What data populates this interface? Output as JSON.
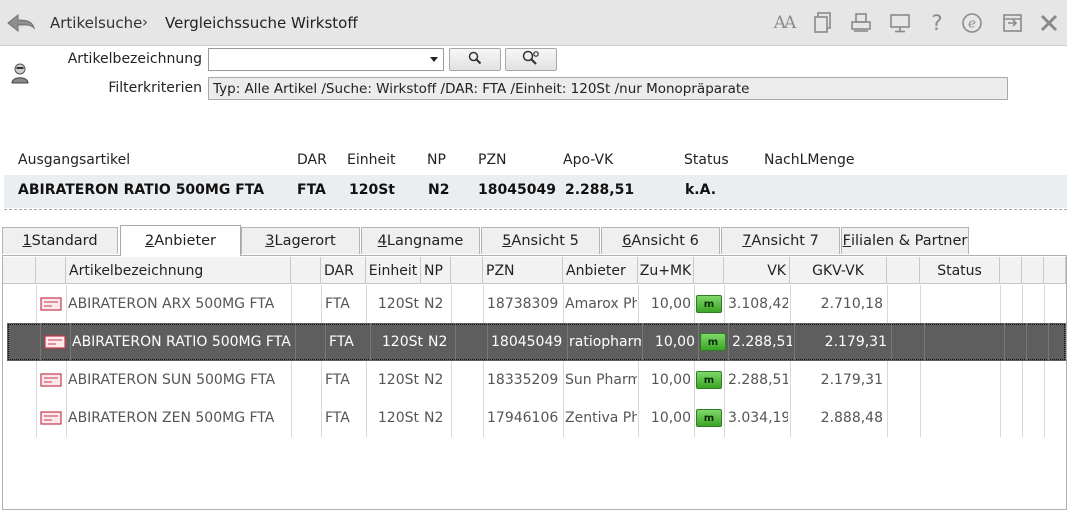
{
  "header": {
    "breadcrumb_1": "Artikelsuche",
    "breadcrumb_sep": "›",
    "breadcrumb_2": "Vergleichssuche Wirkstoff",
    "icons": [
      "font-size-icon",
      "copy-icon",
      "print-icon",
      "monitor-icon",
      "help-icon",
      "e-icon",
      "export-icon",
      "close-icon"
    ],
    "font_icon_text": "AA",
    "help_text": "?"
  },
  "search": {
    "label_artikel": "Artikelbezeichnung",
    "artikel_value": "",
    "label_filter": "Filterkriterien",
    "filter_value": "Typ: Alle Artikel /Suche: Wirkstoff /DAR: FTA /Einheit: 120St /nur Monopräparate"
  },
  "source": {
    "headers": {
      "article": "Ausgangsartikel",
      "dar": "DAR",
      "unit": "Einheit",
      "np": "NP",
      "pzn": "PZN",
      "apo_vk": "Apo-VK",
      "status": "Status",
      "nachl": "NachLMenge"
    },
    "values": {
      "article": "ABIRATERON RATIO 500MG FTA",
      "dar": "FTA",
      "unit": "120St",
      "np": "N2",
      "pzn": "18045049",
      "apo_vk": "2.288,51",
      "status": "k.A.",
      "nachl": ""
    }
  },
  "tabs": [
    {
      "key": "1",
      "label": " Standard"
    },
    {
      "key": "2",
      "label": " Anbieter"
    },
    {
      "key": "3",
      "label": " Lagerort"
    },
    {
      "key": "4",
      "label": " Langname"
    },
    {
      "key": "5",
      "label": " Ansicht 5"
    },
    {
      "key": "6",
      "label": " Ansicht 6"
    },
    {
      "key": "7",
      "label": " Ansicht 7"
    },
    {
      "key": "F",
      "label": "ilialen & Partner"
    }
  ],
  "active_tab": 1,
  "grid": {
    "columns": {
      "name": "Artikelbezeichnung",
      "dar": "DAR",
      "unit": "Einheit",
      "np": "NP",
      "pzn": "PZN",
      "anbieter": "Anbieter",
      "zumk": "Zu+MK",
      "vk": "VK",
      "gkvvk": "GKV-VK",
      "status": "Status"
    },
    "rows": [
      {
        "name": "ABIRATERON ARX 500MG FTA",
        "dar": "FTA",
        "unit": "120St",
        "np": "N2",
        "pzn": "18738309",
        "anbieter": "Amarox Ph",
        "zumk": "10,00",
        "badge": "m",
        "vk": "3.108,42",
        "gkvvk": "2.710,18",
        "status": ""
      },
      {
        "name": "ABIRATERON RATIO 500MG FTA",
        "dar": "FTA",
        "unit": "120St",
        "np": "N2",
        "pzn": "18045049",
        "anbieter": "ratiopharm",
        "zumk": "10,00",
        "badge": "m",
        "vk": "2.288,51",
        "gkvvk": "2.179,31",
        "status": ""
      },
      {
        "name": "ABIRATERON SUN 500MG FTA",
        "dar": "FTA",
        "unit": "120St",
        "np": "N2",
        "pzn": "18335209",
        "anbieter": "Sun Pharm",
        "zumk": "10,00",
        "badge": "m",
        "vk": "2.288,51",
        "gkvvk": "2.179,31",
        "status": ""
      },
      {
        "name": "ABIRATERON ZEN 500MG FTA",
        "dar": "FTA",
        "unit": "120St",
        "np": "N2",
        "pzn": "17946106",
        "anbieter": "Zentiva Ph",
        "zumk": "10,00",
        "badge": "m",
        "vk": "3.034,19",
        "gkvvk": "2.888,48",
        "status": ""
      }
    ],
    "selected_row": 1,
    "red_mark": "▸"
  },
  "colors": {
    "selected_row_bg": "#5e5e5e",
    "badge_green": "#3aa526",
    "title_bg": "#e6e6e6"
  }
}
